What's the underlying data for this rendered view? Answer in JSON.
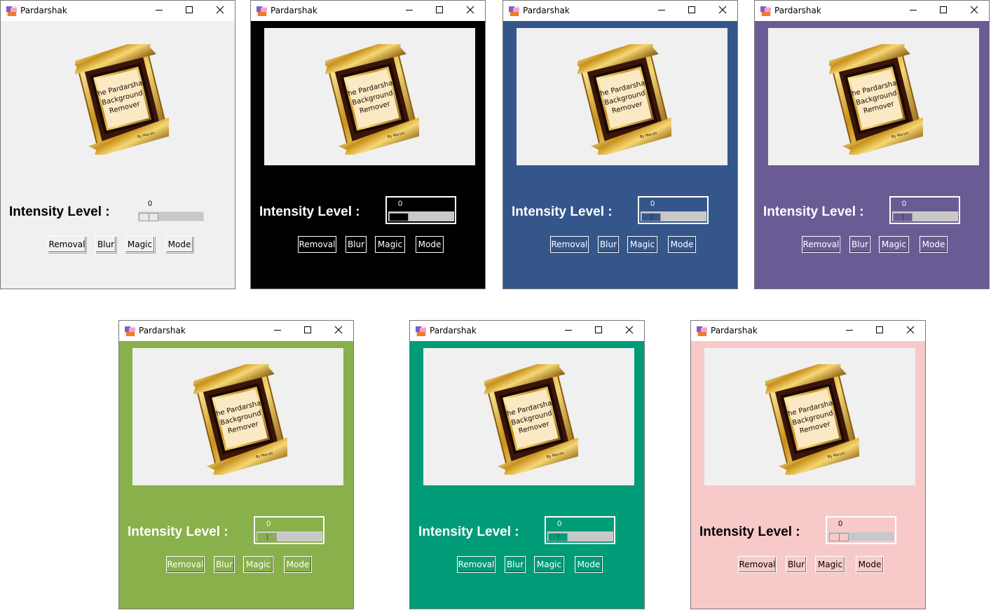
{
  "windows": [
    {
      "title": "Pardarshak",
      "theme": {
        "bg": "#f0f0f0",
        "fg": "#000000",
        "panel_visible": false,
        "scale_border": false,
        "trough": "#c8c8c8",
        "thumb": "#e8e8e8"
      },
      "logo": {
        "line1": "The Pardarshak",
        "line2": "Background",
        "line3": "Remover",
        "byline": "By Marvin"
      },
      "intensity_label": "Intensity Level :",
      "scale_value": "0",
      "buttons": {
        "removal": "Removal",
        "blur": "Blur",
        "magic": "Magic",
        "mode": "Mode"
      }
    },
    {
      "title": "Pardarshak",
      "theme": {
        "bg": "#000000",
        "fg": "#ffffff",
        "panel_visible": true,
        "scale_border": true,
        "trough": "#c8c8c8",
        "thumb": "#000000"
      },
      "logo": {
        "line1": "The Pardarshak",
        "line2": "Background",
        "line3": "Remover",
        "byline": "By Marvin"
      },
      "intensity_label": "Intensity Level :",
      "scale_value": "0",
      "buttons": {
        "removal": "Removal",
        "blur": "Blur",
        "magic": "Magic",
        "mode": "Mode"
      }
    },
    {
      "title": "Pardarshak",
      "theme": {
        "bg": "#34568b",
        "fg": "#ffffff",
        "panel_visible": true,
        "scale_border": true,
        "trough": "#c8c8c8",
        "thumb": "#34568b"
      },
      "logo": {
        "line1": "The Pardarshak",
        "line2": "Background",
        "line3": "Remover",
        "byline": "By Marvin"
      },
      "intensity_label": "Intensity Level :",
      "scale_value": "0",
      "buttons": {
        "removal": "Removal",
        "blur": "Blur",
        "magic": "Magic",
        "mode": "Mode"
      }
    },
    {
      "title": "Pardarshak",
      "theme": {
        "bg": "#6b5b95",
        "fg": "#ffffff",
        "panel_visible": true,
        "scale_border": true,
        "trough": "#c8c8c8",
        "thumb": "#6b5b95"
      },
      "logo": {
        "line1": "The Pardarshak",
        "line2": "Background",
        "line3": "Remover",
        "byline": "By Marvin"
      },
      "intensity_label": "Intensity Level :",
      "scale_value": "0",
      "buttons": {
        "removal": "Removal",
        "blur": "Blur",
        "magic": "Magic",
        "mode": "Mode"
      }
    },
    {
      "title": "Pardarshak",
      "theme": {
        "bg": "#88b04b",
        "fg": "#ffffff",
        "panel_visible": true,
        "scale_border": true,
        "trough": "#c8c8c8",
        "thumb": "#88b04b"
      },
      "logo": {
        "line1": "The Pardarshak",
        "line2": "Background",
        "line3": "Remover",
        "byline": "By Marvin"
      },
      "intensity_label": "Intensity Level :",
      "scale_value": "0",
      "buttons": {
        "removal": "Removal",
        "blur": "Blur",
        "magic": "Magic",
        "mode": "Mode"
      }
    },
    {
      "title": "Pardarshak",
      "theme": {
        "bg": "#009b77",
        "fg": "#ffffff",
        "panel_visible": true,
        "scale_border": true,
        "trough": "#c8c8c8",
        "thumb": "#009b77"
      },
      "logo": {
        "line1": "The Pardarshak",
        "line2": "Background",
        "line3": "Remover",
        "byline": "By Marvin"
      },
      "intensity_label": "Intensity Level :",
      "scale_value": "0",
      "buttons": {
        "removal": "Removal",
        "blur": "Blur",
        "magic": "Magic",
        "mode": "Mode"
      }
    },
    {
      "title": "Pardarshak",
      "theme": {
        "bg": "#f7cac9",
        "fg": "#000000",
        "panel_visible": true,
        "scale_border": true,
        "trough": "#c8c8c8",
        "thumb": "#f7cac9"
      },
      "logo": {
        "line1": "The Pardarshak",
        "line2": "Background",
        "line3": "Remover",
        "byline": "By Marvin"
      },
      "intensity_label": "Intensity Level :",
      "scale_value": "0",
      "buttons": {
        "removal": "Removal",
        "blur": "Blur",
        "magic": "Magic",
        "mode": "Mode"
      }
    }
  ]
}
